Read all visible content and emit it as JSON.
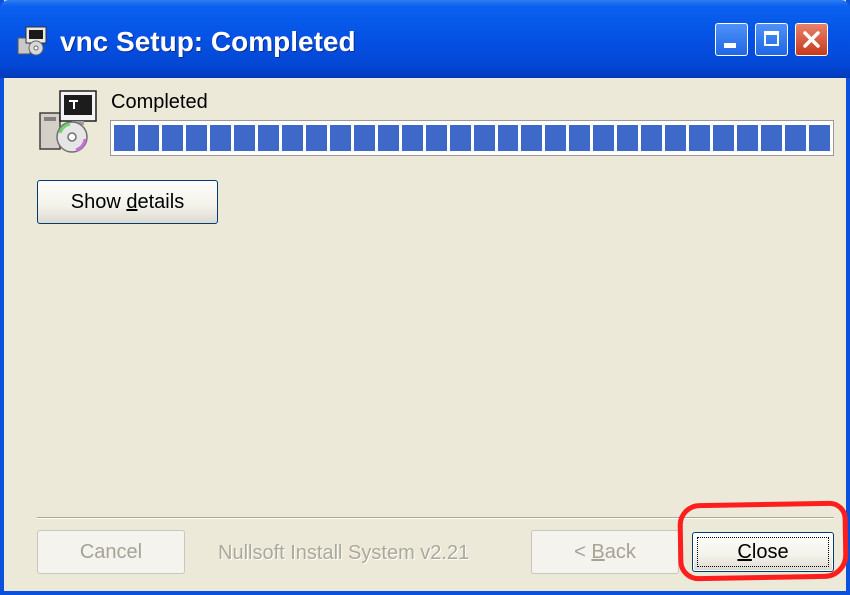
{
  "window": {
    "title": "vnc Setup: Completed",
    "controls": {
      "minimize_icon": "minimize-icon",
      "maximize_icon": "maximize-icon",
      "close_icon": "close-icon"
    }
  },
  "status": {
    "label": "Completed",
    "progress_percent": 100,
    "segments_total": 30
  },
  "buttons": {
    "show_details": {
      "prefix": "Show ",
      "accel": "d",
      "suffix": "etails"
    },
    "cancel": "Cancel",
    "back": {
      "prefix": "< ",
      "accel": "B",
      "suffix": "ack"
    },
    "close": {
      "accel": "C",
      "suffix": "lose"
    }
  },
  "footer": {
    "brand": "Nullsoft Install System v2.21"
  },
  "colors": {
    "titlebar": "#0553e6",
    "progress_fill": "#3f69c9",
    "window_bg": "#ece9d8",
    "annotation": "#ff1e1e"
  },
  "icons": [
    "installer-icon",
    "app-icon",
    "minimize-icon",
    "maximize-icon",
    "close-icon"
  ]
}
